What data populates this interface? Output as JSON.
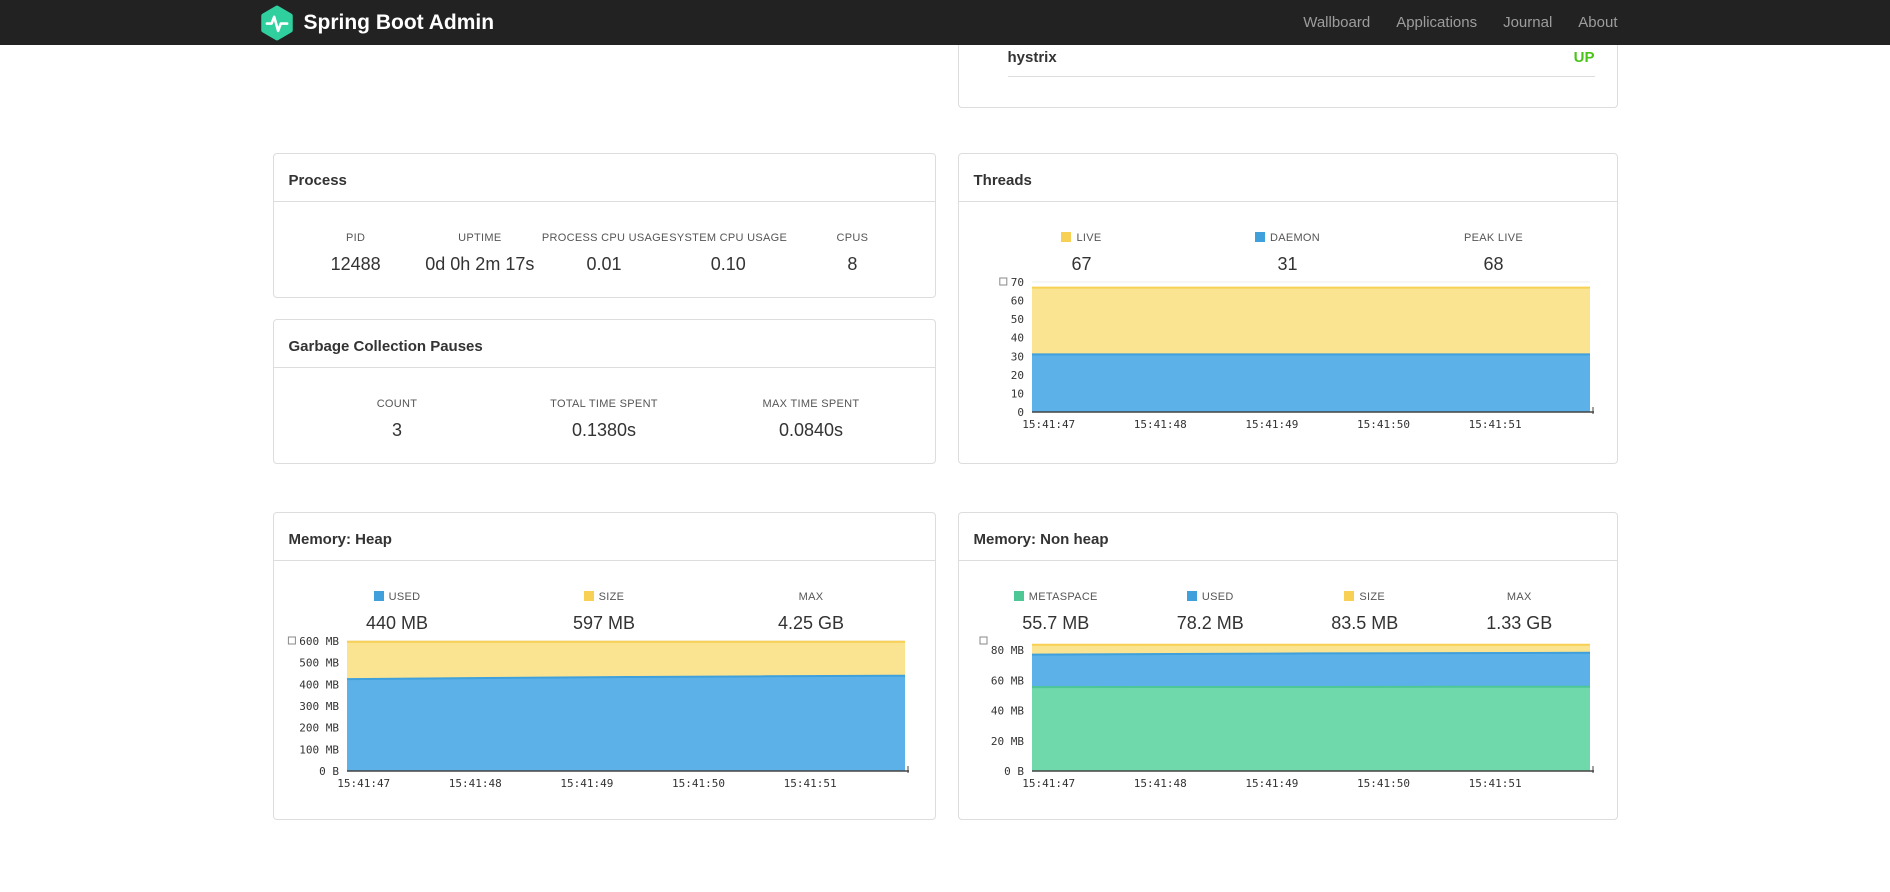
{
  "navbar": {
    "brand": "Spring Boot Admin",
    "links": [
      {
        "label": "Wallboard"
      },
      {
        "label": "Applications"
      },
      {
        "label": "Journal"
      },
      {
        "label": "About"
      }
    ],
    "background": "#222222",
    "link_color": "#9d9d9d"
  },
  "health_panel": {
    "row": {
      "name": "hystrix",
      "status": "UP",
      "status_color": "#48c418"
    }
  },
  "process_panel": {
    "title": "Process",
    "metrics": [
      {
        "label": "PID",
        "value": "12488"
      },
      {
        "label": "UPTIME",
        "value": "0d 0h 2m 17s"
      },
      {
        "label": "PROCESS CPU USAGE",
        "value": "0.01"
      },
      {
        "label": "SYSTEM CPU USAGE",
        "value": "0.10"
      },
      {
        "label": "CPUS",
        "value": "8"
      }
    ]
  },
  "gc_panel": {
    "title": "Garbage Collection Pauses",
    "metrics": [
      {
        "label": "COUNT",
        "value": "3"
      },
      {
        "label": "TOTAL TIME SPENT",
        "value": "0.1380s"
      },
      {
        "label": "MAX TIME SPENT",
        "value": "0.0840s"
      }
    ]
  },
  "threads_panel": {
    "title": "Threads",
    "legend": [
      {
        "label": "LIVE",
        "value": "67",
        "color": "#f8d053"
      },
      {
        "label": "DAEMON",
        "value": "31",
        "color": "#3fa0dc"
      },
      {
        "label": "PEAK LIVE",
        "value": "68",
        "color": null
      }
    ]
  },
  "heap_panel": {
    "title": "Memory: Heap",
    "legend": [
      {
        "label": "USED",
        "value": "440 MB",
        "color": "#3fa0dc"
      },
      {
        "label": "SIZE",
        "value": "597 MB",
        "color": "#f8d053"
      },
      {
        "label": "MAX",
        "value": "4.25 GB",
        "color": null
      }
    ]
  },
  "nonheap_panel": {
    "title": "Memory: Non heap",
    "legend": [
      {
        "label": "METASPACE",
        "value": "55.7 MB",
        "color": "#4cc795"
      },
      {
        "label": "USED",
        "value": "78.2 MB",
        "color": "#3fa0dc"
      },
      {
        "label": "SIZE",
        "value": "83.5 MB",
        "color": "#f8d053"
      },
      {
        "label": "MAX",
        "value": "1.33 GB",
        "color": null
      }
    ]
  },
  "chart_data": [
    {
      "id": "threads",
      "type": "area",
      "title": "Threads",
      "x": [
        "15:41:47",
        "15:41:48",
        "15:41:49",
        "15:41:50",
        "15:41:51"
      ],
      "ylim": [
        0,
        70
      ],
      "yticks": [
        [
          0,
          "0"
        ],
        [
          10,
          "10"
        ],
        [
          20,
          "20"
        ],
        [
          30,
          "30"
        ],
        [
          40,
          "40"
        ],
        [
          50,
          "50"
        ],
        [
          60,
          "60"
        ],
        [
          70,
          "70"
        ]
      ],
      "series": [
        {
          "name": "LIVE",
          "color": "#f8d053",
          "fill": "#fbe491",
          "values": [
            67,
            67,
            67,
            67,
            67
          ]
        },
        {
          "name": "DAEMON",
          "color": "#3fa0dc",
          "fill": "#5bb1e8",
          "values": [
            31,
            31,
            31,
            31,
            31
          ]
        }
      ]
    },
    {
      "id": "heap",
      "type": "area",
      "title": "Memory: Heap",
      "x": [
        "15:41:47",
        "15:41:48",
        "15:41:49",
        "15:41:50",
        "15:41:51"
      ],
      "ylim": [
        0,
        600
      ],
      "yticks": [
        [
          0,
          "0 B"
        ],
        [
          100,
          "100 MB"
        ],
        [
          200,
          "200 MB"
        ],
        [
          300,
          "300 MB"
        ],
        [
          400,
          "400 MB"
        ],
        [
          500,
          "500 MB"
        ],
        [
          600,
          "600 MB"
        ]
      ],
      "series": [
        {
          "name": "SIZE",
          "color": "#f8d053",
          "fill": "#fbe491",
          "values": [
            597,
            597,
            597,
            597,
            597
          ]
        },
        {
          "name": "USED",
          "color": "#3fa0dc",
          "fill": "#5bb1e8",
          "values": [
            424,
            429,
            434,
            437,
            440
          ]
        }
      ]
    },
    {
      "id": "nonheap",
      "type": "area",
      "title": "Memory: Non heap",
      "x": [
        "15:41:47",
        "15:41:48",
        "15:41:49",
        "15:41:50",
        "15:41:51"
      ],
      "ylim": [
        0,
        86
      ],
      "yticks": [
        [
          0,
          "0 B"
        ],
        [
          20,
          "20 MB"
        ],
        [
          40,
          "40 MB"
        ],
        [
          60,
          "60 MB"
        ],
        [
          80,
          "80 MB"
        ]
      ],
      "series": [
        {
          "name": "SIZE",
          "color": "#f8d053",
          "fill": "#fbe491",
          "values": [
            83.5,
            83.5,
            83.5,
            83.5,
            83.5
          ]
        },
        {
          "name": "USED",
          "color": "#3fa0dc",
          "fill": "#5bb1e8",
          "values": [
            77.0,
            77.4,
            77.8,
            78.0,
            78.2
          ]
        },
        {
          "name": "METASPACE",
          "color": "#4cc795",
          "fill": "#6fd9ac",
          "values": [
            55.5,
            55.6,
            55.6,
            55.7,
            55.7
          ]
        }
      ]
    }
  ]
}
